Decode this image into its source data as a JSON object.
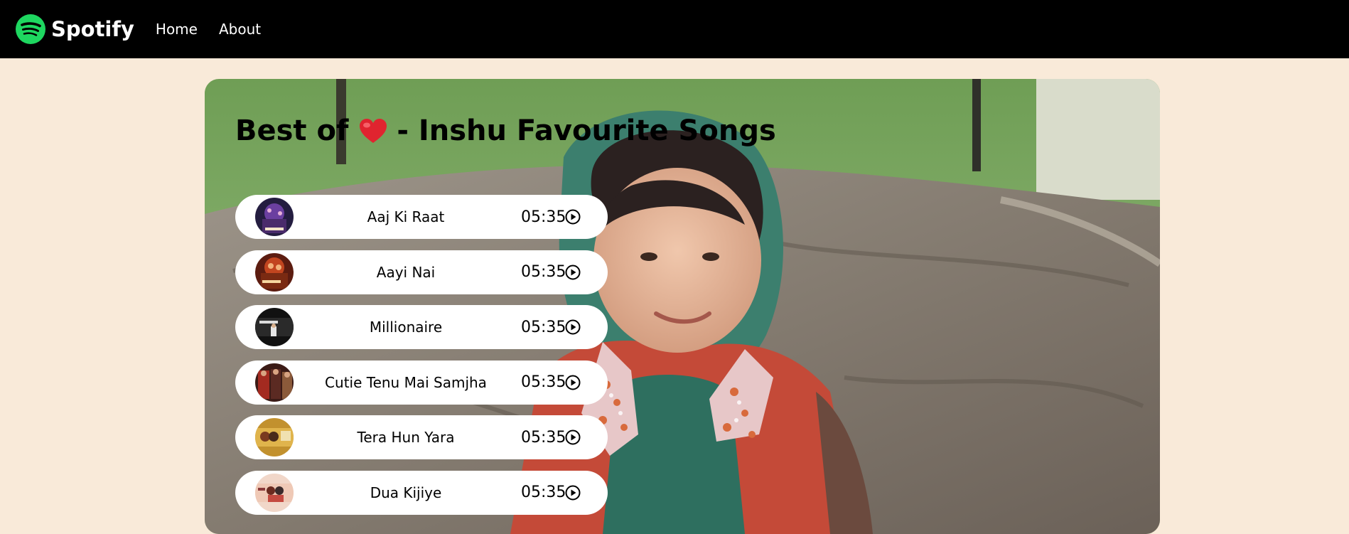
{
  "navbar": {
    "brand": "Spotify",
    "links": [
      "Home",
      "About"
    ]
  },
  "hero": {
    "title_prefix": "Best of",
    "title_suffix": "- Inshu Favourite Songs",
    "heart_icon": "red-heart-emoji"
  },
  "songs": [
    {
      "name": "Aaj Ki Raat",
      "duration": "05:35"
    },
    {
      "name": "Aayi Nai",
      "duration": "05:35"
    },
    {
      "name": "Millionaire",
      "duration": "05:35"
    },
    {
      "name": "Cutie Tenu Mai Samjha",
      "duration": "05:35"
    },
    {
      "name": "Tera Hun Yara",
      "duration": "05:35"
    },
    {
      "name": "Dua Kijiye",
      "duration": "05:35"
    }
  ],
  "colors": {
    "page_bg": "#f9ead9",
    "navbar_bg": "#000000",
    "brand_green": "#1ed760"
  }
}
